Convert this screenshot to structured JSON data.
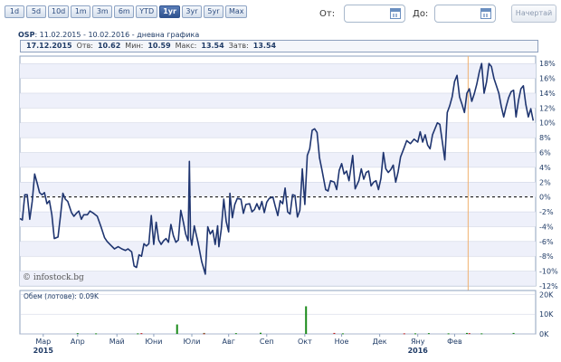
{
  "toolbar": {
    "range_buttons": [
      "1d",
      "5d",
      "10d",
      "1m",
      "3m",
      "6m",
      "YTD",
      "1yr",
      "3yr",
      "5yr",
      "Max"
    ],
    "active_range": "1yr",
    "from_label": "От:",
    "to_label": "До:",
    "from_value": "",
    "to_value": "",
    "draw_button": "Начертай"
  },
  "chart": {
    "symbol": "OSP",
    "title_rest": ": 11.02.2015 - 10.02.2016 - дневна графика",
    "watermark": "© infostock.bg",
    "volume_label": "Обем (лотове): 0.09K"
  },
  "info": {
    "date": "17.12.2015",
    "open_label": "Отв:",
    "open_value": "10.62",
    "min_label": "Мин:",
    "min_value": "10.59",
    "max_label": "Макс:",
    "max_value": "13.54",
    "close_label": "Затв:",
    "close_value": "13.54"
  },
  "colors": {
    "line": "#1f3570",
    "band": "#eef0fa",
    "grid": "#c9cfe0",
    "zero_line": "#000000",
    "marker": "#f0b070",
    "volume_up": "#1a8a1a",
    "volume_down": "#c02020"
  },
  "chart_data": {
    "type": "line",
    "x_ticks": [
      "Мар",
      "Апр",
      "Май",
      "Юни",
      "Юли",
      "Авг",
      "Сеп",
      "Окт",
      "Ное",
      "Дек",
      "Яну",
      "Фев"
    ],
    "year_labels": [
      "2015",
      "2016"
    ],
    "y_ticks": [
      "18%",
      "16%",
      "14%",
      "12%",
      "10%",
      "8%",
      "6%",
      "4%",
      "2%",
      "0%",
      "-2%",
      "-4%",
      "-6%",
      "-8%",
      "-10%",
      "-12%"
    ],
    "ylim": [
      -12,
      19
    ],
    "volume_ticks": [
      "20K",
      "10K",
      "0K"
    ],
    "volume_ylim": [
      0,
      22
    ],
    "x_range": [
      0,
      365
    ],
    "series": [
      {
        "values": [
          [
            0,
            -2.9
          ],
          [
            2,
            -3.1
          ],
          [
            4,
            0.3
          ],
          [
            6,
            0.3
          ],
          [
            8,
            -3
          ],
          [
            10,
            -0.6
          ],
          [
            12,
            3.1
          ],
          [
            14,
            1.9
          ],
          [
            16,
            0.6
          ],
          [
            18,
            0.3
          ],
          [
            20,
            0.6
          ],
          [
            22,
            -0.9
          ],
          [
            24,
            -0.5
          ],
          [
            26,
            -2.4
          ],
          [
            28,
            -5.6
          ],
          [
            31,
            -5.4
          ],
          [
            33,
            -2.6
          ],
          [
            35,
            0.5
          ],
          [
            37,
            -0.3
          ],
          [
            39,
            -0.6
          ],
          [
            42,
            -2.1
          ],
          [
            44,
            -2.6
          ],
          [
            46,
            -2.2
          ],
          [
            48,
            -1.9
          ],
          [
            50,
            -3.0
          ],
          [
            52,
            -2.4
          ],
          [
            55,
            -2.4
          ],
          [
            57,
            -1.9
          ],
          [
            60,
            -2.2
          ],
          [
            63,
            -2.6
          ],
          [
            66,
            -4.0
          ],
          [
            69,
            -5.5
          ],
          [
            71,
            -6.0
          ],
          [
            74,
            -6.5
          ],
          [
            77,
            -7.0
          ],
          [
            80,
            -6.7
          ],
          [
            83,
            -7.0
          ],
          [
            86,
            -7.2
          ],
          [
            88,
            -7.0
          ],
          [
            91,
            -7.4
          ],
          [
            93,
            -9.3
          ],
          [
            95,
            -9.5
          ],
          [
            97,
            -7.8
          ],
          [
            99,
            -8.0
          ],
          [
            101,
            -6.3
          ],
          [
            103,
            -6.6
          ],
          [
            105,
            -6.3
          ],
          [
            107,
            -2.5
          ],
          [
            109,
            -6.4
          ],
          [
            111,
            -3.4
          ],
          [
            113,
            -5.8
          ],
          [
            115,
            -6.4
          ],
          [
            117,
            -5.9
          ],
          [
            119,
            -5.6
          ],
          [
            121,
            -6.1
          ],
          [
            123,
            -3.7
          ],
          [
            125,
            -5.2
          ],
          [
            127,
            -6.1
          ],
          [
            129,
            -5.8
          ],
          [
            131,
            -1.8
          ],
          [
            133,
            -3.3
          ],
          [
            135,
            -5.0
          ],
          [
            137,
            -5.9
          ],
          [
            138,
            4.8
          ],
          [
            139,
            -5.5
          ],
          [
            140,
            -6.5
          ],
          [
            142,
            -3.9
          ],
          [
            145,
            -6.1
          ],
          [
            148,
            -8.7
          ],
          [
            151,
            -10.4
          ],
          [
            153,
            -4.0
          ],
          [
            155,
            -5.0
          ],
          [
            157,
            -4.5
          ],
          [
            159,
            -6.4
          ],
          [
            161,
            -3.9
          ],
          [
            162,
            -6.7
          ],
          [
            164,
            -4.3
          ],
          [
            166,
            -0.3
          ],
          [
            168,
            -3.3
          ],
          [
            170,
            -4.7
          ],
          [
            171,
            0.5
          ],
          [
            173,
            -2.8
          ],
          [
            175,
            -1.0
          ],
          [
            177,
            -0.2
          ],
          [
            180,
            -0.3
          ],
          [
            182,
            -2.2
          ],
          [
            184,
            -1.0
          ],
          [
            187,
            -0.9
          ],
          [
            189,
            -2.0
          ],
          [
            191,
            -1.7
          ],
          [
            193,
            -0.9
          ],
          [
            195,
            -1.7
          ],
          [
            197,
            -0.6
          ],
          [
            199,
            -2.1
          ],
          [
            201,
            -0.7
          ],
          [
            203,
            -0.2
          ],
          [
            206,
            0.0
          ],
          [
            208,
            -1.3
          ],
          [
            210,
            -2.5
          ],
          [
            212,
            -0.5
          ],
          [
            214,
            -0.9
          ],
          [
            216,
            1.2
          ],
          [
            218,
            -2.0
          ],
          [
            220,
            -2.3
          ],
          [
            222,
            0.3
          ],
          [
            224,
            0.2
          ],
          [
            226,
            -2.7
          ],
          [
            228,
            -1.8
          ],
          [
            230,
            3.8
          ],
          [
            232,
            -1.0
          ],
          [
            234,
            5.6
          ],
          [
            236,
            6.5
          ],
          [
            238,
            9.0
          ],
          [
            240,
            9.2
          ],
          [
            242,
            8.7
          ],
          [
            244,
            5.3
          ],
          [
            246,
            3.6
          ],
          [
            249,
            1.0
          ],
          [
            251,
            0.8
          ],
          [
            253,
            2.2
          ],
          [
            256,
            2.0
          ],
          [
            258,
            1.0
          ],
          [
            260,
            3.6
          ],
          [
            262,
            4.5
          ],
          [
            264,
            3.1
          ],
          [
            266,
            3.5
          ],
          [
            268,
            2.2
          ],
          [
            271,
            5.6
          ],
          [
            273,
            1.1
          ],
          [
            276,
            2.2
          ],
          [
            278,
            3.8
          ],
          [
            280,
            2.4
          ],
          [
            282,
            3.3
          ],
          [
            284,
            3.5
          ],
          [
            286,
            1.5
          ],
          [
            288,
            2.0
          ],
          [
            290,
            2.2
          ],
          [
            292,
            1.0
          ],
          [
            294,
            2.5
          ],
          [
            296,
            6.0
          ],
          [
            298,
            3.8
          ],
          [
            300,
            3.3
          ],
          [
            302,
            3.7
          ],
          [
            304,
            4.3
          ],
          [
            306,
            2.0
          ],
          [
            308,
            3.4
          ],
          [
            310,
            5.4
          ],
          [
            313,
            6.7
          ],
          [
            315,
            7.6
          ],
          [
            318,
            7.2
          ],
          [
            321,
            7.8
          ],
          [
            324,
            7.4
          ],
          [
            326,
            8.8
          ],
          [
            328,
            7.4
          ],
          [
            330,
            8.4
          ],
          [
            332,
            7.0
          ],
          [
            334,
            6.5
          ],
          [
            336,
            8.4
          ],
          [
            338,
            9.2
          ],
          [
            340,
            10.0
          ],
          [
            342,
            9.8
          ],
          [
            344,
            7.4
          ],
          [
            346,
            5.0
          ],
          [
            348,
            11.4
          ],
          [
            350,
            12.3
          ],
          [
            352,
            13.5
          ],
          [
            354,
            15.6
          ],
          [
            356,
            16.4
          ],
          [
            358,
            13.5
          ],
          [
            360,
            12.5
          ],
          [
            362,
            11.4
          ],
          [
            364,
            14.0
          ],
          [
            366,
            14.6
          ],
          [
            368,
            12.9
          ],
          [
            370,
            13.9
          ],
          [
            372,
            15.2
          ],
          [
            374,
            16.8
          ],
          [
            376,
            18.0
          ],
          [
            378,
            14.0
          ],
          [
            380,
            15.5
          ],
          [
            382,
            18.0
          ],
          [
            384,
            17.6
          ],
          [
            386,
            16.0
          ],
          [
            388,
            15.0
          ],
          [
            390,
            14.0
          ],
          [
            392,
            12.2
          ],
          [
            394,
            10.8
          ],
          [
            396,
            12.2
          ],
          [
            398,
            13.4
          ],
          [
            400,
            14.2
          ],
          [
            402,
            14.4
          ],
          [
            404,
            10.8
          ],
          [
            406,
            13.0
          ],
          [
            408,
            14.6
          ],
          [
            410,
            15.0
          ],
          [
            412,
            12.5
          ],
          [
            414,
            10.8
          ],
          [
            416,
            11.9
          ],
          [
            418,
            10.3
          ]
        ]
      }
    ],
    "volume": [
      [
        47,
        0.4
      ],
      [
        62,
        0.3
      ],
      [
        96,
        0.3
      ],
      [
        128,
        4.8
      ],
      [
        150,
        0.5
      ],
      [
        176,
        0.4
      ],
      [
        196,
        0.6
      ],
      [
        233,
        14.0
      ],
      [
        263,
        0.3
      ],
      [
        322,
        0.3
      ],
      [
        333,
        0.4
      ],
      [
        349,
        0.3
      ],
      [
        364,
        0.5
      ],
      [
        376,
        0.3
      ],
      [
        402,
        0.5
      ]
    ],
    "volume_down": [
      [
        99,
        0.4
      ],
      [
        150,
        0.3
      ],
      [
        256,
        0.5
      ],
      [
        313,
        0.3
      ],
      [
        366,
        0.4
      ]
    ],
    "marker_x": 365,
    "grid": true,
    "legend": "none"
  }
}
